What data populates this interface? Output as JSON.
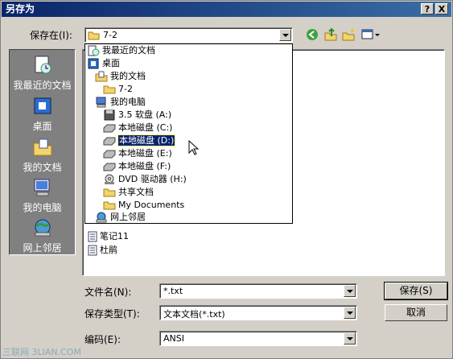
{
  "window": {
    "title": "另存为"
  },
  "titlebar_buttons": {
    "help": "?",
    "close": "X"
  },
  "save_in": {
    "label": "保存在(I):",
    "value": "7-2"
  },
  "places": [
    {
      "name": "recent",
      "label": "我最近的文档"
    },
    {
      "name": "desktop",
      "label": "桌面"
    },
    {
      "name": "mydocs",
      "label": "我的文档"
    },
    {
      "name": "mycomputer",
      "label": "我的电脑"
    },
    {
      "name": "network",
      "label": "网上邻居"
    }
  ],
  "dropdown_items": [
    {
      "label": "我最近的文档",
      "icon": "recent-docs-icon"
    },
    {
      "label": "桌面",
      "icon": "desktop-icon"
    },
    {
      "label": "我的文档",
      "icon": "my-documents-icon"
    },
    {
      "label": "7-2",
      "icon": "folder-open-icon"
    },
    {
      "label": "我的电脑",
      "icon": "my-computer-icon"
    },
    {
      "label": "3.5 软盘 (A:)",
      "icon": "floppy-icon"
    },
    {
      "label": "本地磁盘 (C:)",
      "icon": "hard-disk-icon"
    },
    {
      "label": "本地磁盘 (D:)",
      "icon": "hard-disk-icon"
    },
    {
      "label": "本地磁盘 (E:)",
      "icon": "hard-disk-icon"
    },
    {
      "label": "本地磁盘 (F:)",
      "icon": "hard-disk-icon"
    },
    {
      "label": "DVD 驱动器 (H:)",
      "icon": "dvd-drive-icon"
    },
    {
      "label": "共享文档",
      "icon": "folder-icon"
    },
    {
      "label": "My Documents",
      "icon": "folder-icon"
    },
    {
      "label": "网上邻居",
      "icon": "network-icon"
    }
  ],
  "files": [
    {
      "label": "笔记11"
    },
    {
      "label": "杜鹃"
    }
  ],
  "filename": {
    "label": "文件名(N):",
    "value": "*.txt"
  },
  "filetype": {
    "label": "保存类型(T):",
    "value": "文本文档(*.txt)"
  },
  "encoding": {
    "label": "编码(E):",
    "value": "ANSI"
  },
  "buttons": {
    "save": "保存(S)",
    "cancel": "取消"
  },
  "watermark": "三联网 3LIAN.COM"
}
